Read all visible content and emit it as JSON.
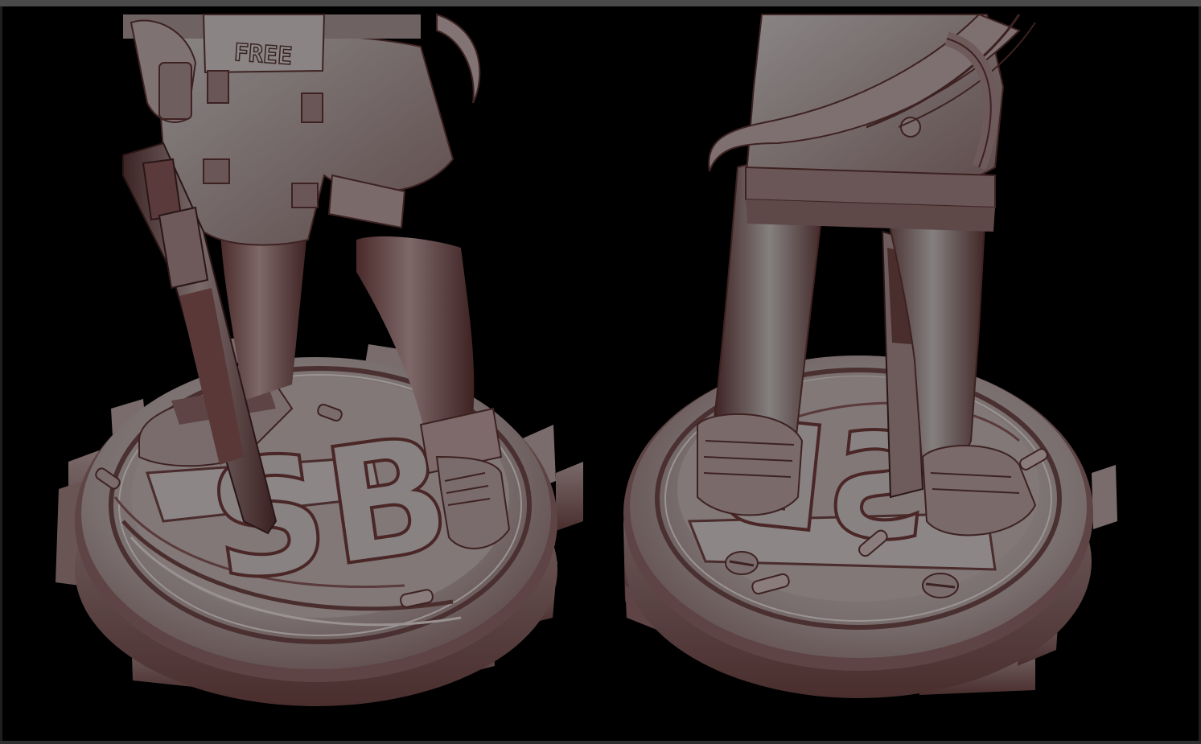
{
  "belt_text": "FREE",
  "base_emblem": "SB",
  "colors": {
    "frame_top": "#4a4a4a",
    "background": "#000000",
    "model_light": "#8e8a8a",
    "model_mid": "#6e5d5d",
    "model_shadow": "#3a2222",
    "cavity": "#5a2c2c"
  },
  "views": [
    {
      "name": "front-three-quarter-view"
    },
    {
      "name": "back-three-quarter-view"
    }
  ]
}
